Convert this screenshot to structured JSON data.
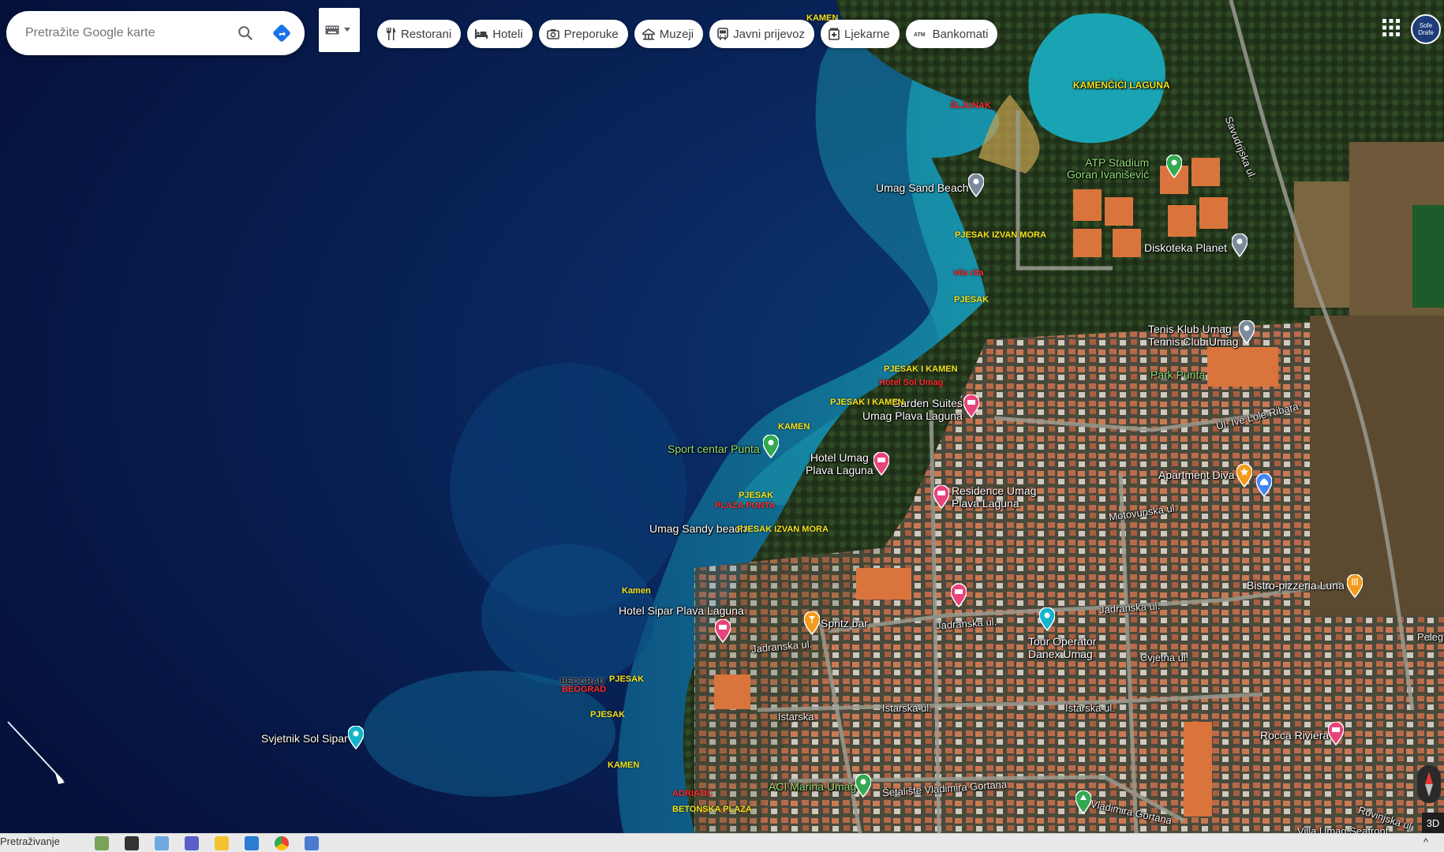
{
  "search": {
    "placeholder": "Pretražite Google karte"
  },
  "chips": [
    {
      "label": "Restorani",
      "icon": "fork-knife-icon"
    },
    {
      "label": "Hoteli",
      "icon": "bed-icon"
    },
    {
      "label": "Preporuke",
      "icon": "camera-icon"
    },
    {
      "label": "Muzeji",
      "icon": "museum-icon"
    },
    {
      "label": "Javni prijevoz",
      "icon": "bus-icon"
    },
    {
      "label": "Ljekarne",
      "icon": "pharmacy-icon"
    },
    {
      "label": "Bankomati",
      "icon": "atm-icon"
    }
  ],
  "account": {
    "avatar_text": "Sofe Drafe"
  },
  "places": {
    "kamencici_laguna": "KAMENČIĆI LAGUNA",
    "atp_stadium": "ATP Stadium\nGoran Ivanišević",
    "umag_sand_beach": "Umag Sand Beach",
    "diskoteka_planet": "Diskoteka Planet",
    "tenis_klub": "Tenis Klub Umag\nTennis Club Umag",
    "park_punta": "Park Punta",
    "garden_suites": "Garden Suites\nUmag Plava Laguna",
    "sport_centar": "Sport centar Punta",
    "hotel_umag": "Hotel Umag\nPlava Laguna",
    "residence_umag": "Residence Umag\nPlava Laguna",
    "apartment_diva": "Apartment Diva",
    "umag_sandy_beach": "Umag Sandy beach",
    "hotel_sipar": "Hotel Sipar Plava Laguna",
    "spritz_bar": "Spritz bar",
    "tour_operator": "Tour Operator\nDanex Umag",
    "bistro_luna": "Bistro-pizzeria Luna",
    "svjetnik": "Svjetnik Sol Sipar",
    "rocca_riviera": "Rocca Riviera",
    "aci_marina": "ACI Marina Umag"
  },
  "roads": {
    "ive_lole_ribara": "Ul. Ive Lole Ribara",
    "motovunska": "Motovunska ul.",
    "jadranska1": "Jadranska ul.",
    "jadranska2": "Jadranska ul.",
    "jadranska3": "Jadranska ul.",
    "istarska1": "Istarska",
    "istarska2": "Istarska ul.",
    "istarska3": "Istarska ul.",
    "cvjetna": "Cvjetna ul.",
    "setaliste": "Šetalište Vladimira Gortana",
    "vladimira_gortana": "Ul. Vladimira Gortana",
    "savudrijska": "Savudrijska ul.",
    "umag_safront": "Villa Umag Seafront",
    "pelegrin": "Pelegrin",
    "rovinjska": "Rovinjska ul."
  },
  "annotations": {
    "kamen_top": "KAMEN",
    "sljunak": "ŠLJUNAK",
    "pjesak_izvan_mora1": "PJESAK IZVAN MORA",
    "vila_rita": "vila rita",
    "pjesak1": "PJESAK",
    "pjesak_i_kamen1": "PJESAK I KAMEN",
    "hotel_sol_umag": "Hotel Sol Umag",
    "pjesak_i_kamen2": "PJESAK I KAMEN",
    "kamen2": "KAMEN",
    "pjesak2": "PJESAK",
    "plaza_punta": "PLAZA PUNTA",
    "pjesak_izvan_mora2": "PJESAK IZVAN MORA",
    "kamen3": "Kamen",
    "beograd": "BEOGRAD",
    "beograd_red": "BEOGRAD",
    "pjesak3": "PJESAK",
    "pjesak4": "PJESAK",
    "kamen4": "KAMEN",
    "adriatic": "ADRIATIC",
    "betonska": "BETONSKA PLAZA"
  },
  "map_controls": {
    "btn_3d": "3D"
  },
  "taskbar": {
    "search_label": "Pretraživanje"
  },
  "colors": {
    "deep_sea": "#06123a",
    "shallow_sea": "#1fa6b8",
    "land": "#2f3d23",
    "clay_court": "#d9753c",
    "pin_pink": "#e8437a",
    "pin_green": "#34a853",
    "pin_teal": "#12b5cb",
    "pin_gray": "#7c8a9c",
    "pin_orange": "#f29b1d"
  }
}
